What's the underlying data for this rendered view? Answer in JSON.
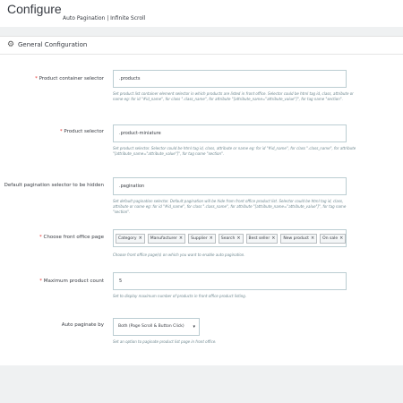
{
  "header": {
    "title": "Configure",
    "subtitle": "Auto Pagination | Infinite Scroll"
  },
  "panel": {
    "title": "General Configuration",
    "icon": "gear-icon"
  },
  "fields": {
    "product_container": {
      "label": "Product container selector",
      "value": ".products",
      "help": "Set product list container element selector in which products are listed in front office. Selector could be html tag id, class, attribute or name eg: for id \"#id_name\", for class \".class_name\", for attribute \"[attribute_name=\"attribute_value\"]\", for tag name \"section\"."
    },
    "product_selector": {
      "label": "Product selector",
      "value": ".product-miniature",
      "help": "Set product selector. Selector could be html tag id, class, attribute or name eg: for id \"#id_name\", for class \".class_name\", for attribute \"[attribute_name=\"attribute_value\"]\", for tag name \"section\"."
    },
    "default_pagination": {
      "label": "Default pagination selector to be hidden",
      "value": ".pagination",
      "help": "Set default pagination selector. Default pagination will be hide from front office product list. Selector could be html tag id, class, attribute or name eg: for id \"#id_name\", for class \".class_name\", for attribute \"[attribute_name=\"attribute_value\"]\", for tag name \"section\"."
    },
    "front_office_page": {
      "label": "Choose front office page",
      "tags": [
        "Category",
        "Manufacturer",
        "Supplier",
        "Search",
        "Best seller",
        "New product",
        "On sale"
      ],
      "help": "Choose front office page(s) on which you want to enable auto pagination."
    },
    "max_product_count": {
      "label": "Maximum product count",
      "value": "5",
      "help": "Set to display maximum number of products in front office product listing."
    },
    "auto_paginate_by": {
      "label": "Auto paginate by",
      "value": "Both (Page Scroll & Button Click)",
      "help": "Set an option to paginate product list page in front office."
    }
  },
  "colors": {
    "required": "#e5322e",
    "border": "#bbcdd2",
    "help_text": "#6c868e"
  }
}
